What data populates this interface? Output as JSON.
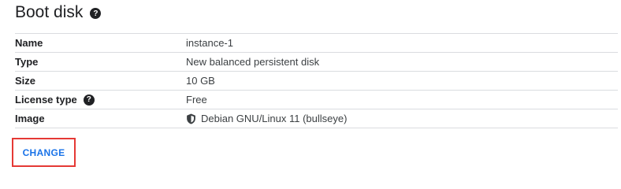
{
  "section": {
    "title": "Boot disk",
    "help_icon": "question-circle-icon"
  },
  "rows": [
    {
      "label": "Name",
      "value": "instance-1"
    },
    {
      "label": "Type",
      "value": "New balanced persistent disk"
    },
    {
      "label": "Size",
      "value": "10 GB"
    },
    {
      "label": "License type",
      "value": "Free",
      "help_icon": "question-circle-icon"
    },
    {
      "label": "Image",
      "value": "Debian GNU/Linux 11 (bullseye)",
      "icon": "shield-icon"
    }
  ],
  "actions": {
    "change_label": "CHANGE"
  },
  "colors": {
    "accent": "#1a73e8",
    "highlight_border": "#e53935",
    "divider": "#dadce0"
  }
}
